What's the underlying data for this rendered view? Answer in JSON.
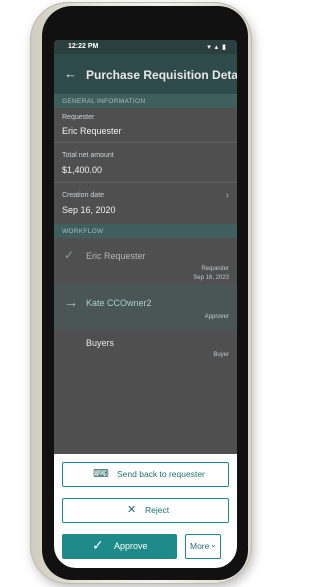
{
  "status_bar": {
    "time": "12:22 PM",
    "icons": "▾ ▴ ▮"
  },
  "app_bar": {
    "title": "Purchase Requisition Details",
    "back_icon": "arrow-left-icon"
  },
  "general": {
    "header": "GENERAL INFORMATION",
    "requester_label": "Requester",
    "requester_value": "Eric Requester",
    "net_amount_label": "Total net amount",
    "net_amount_value": "$1,400.00",
    "creation_label": "Creation date",
    "creation_value": "Sep 16, 2020"
  },
  "workflow": {
    "header": "WORKFLOW",
    "steps": [
      {
        "name": "Eric Requester",
        "role": "Requester",
        "date": "Sep 16, 2023",
        "icon": "checkmark-icon"
      },
      {
        "name": "Kate CCOwner2",
        "role": "Approver",
        "icon": "arrow-right-icon"
      },
      {
        "name": "Buyers",
        "role": "Buyer"
      }
    ]
  },
  "actions": {
    "send_back_label": "Send back to requester",
    "reject_label": "Reject",
    "approve_label": "Approve",
    "more_label": "More"
  },
  "colors": {
    "accent": "#1e8a8a",
    "app_bar": "#2e4a4a",
    "overlay": "#4f4f4f"
  }
}
